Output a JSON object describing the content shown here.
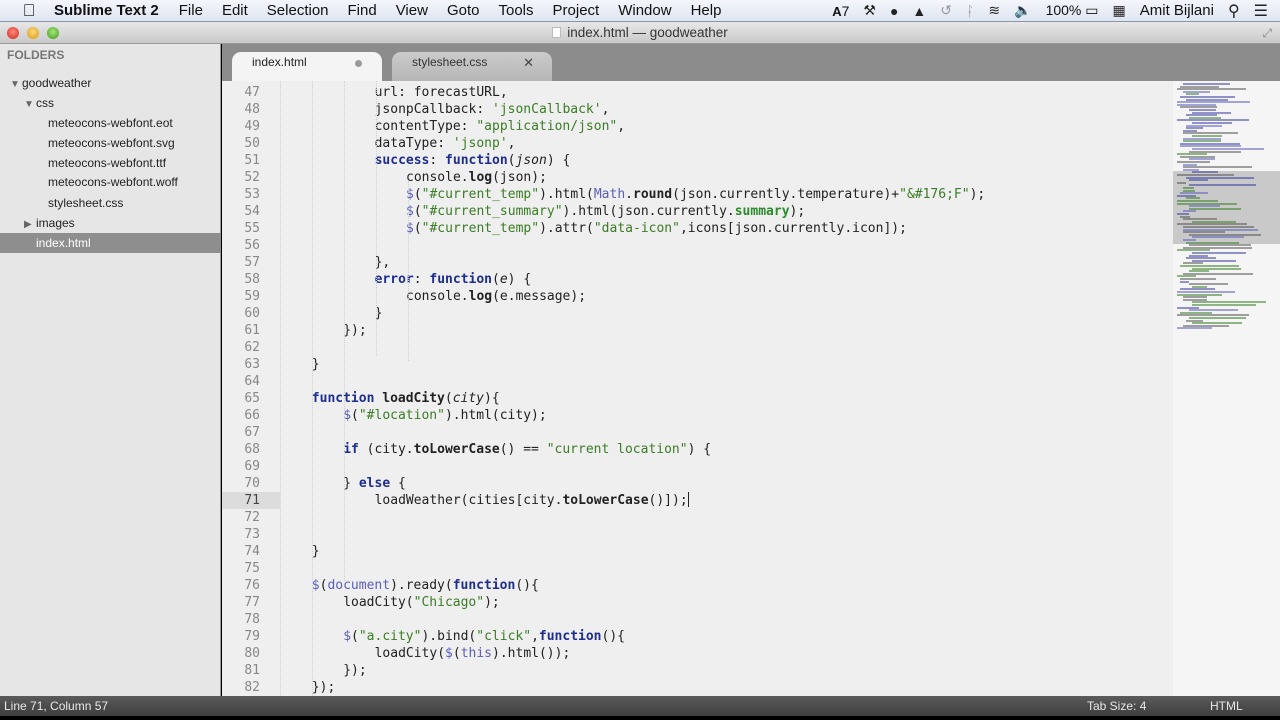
{
  "menubar": {
    "app_name": "Sublime Text 2",
    "items": [
      "File",
      "Edit",
      "Selection",
      "Find",
      "View",
      "Goto",
      "Tools",
      "Project",
      "Window",
      "Help"
    ],
    "status_icons": [
      "adobe-icon",
      "anvil-icon",
      "growl-icon",
      "airplay-icon",
      "time-machine-icon",
      "bluetooth-icon",
      "wifi-icon",
      "volume-icon"
    ],
    "adobe_badge": "7",
    "battery": "100%",
    "user": "Amit Bijlani"
  },
  "window": {
    "title": "index.html — goodweather"
  },
  "sidebar": {
    "header": "FOLDERS",
    "tree": [
      {
        "label": "goodweather",
        "type": "folder",
        "expanded": true,
        "depth": 0
      },
      {
        "label": "css",
        "type": "folder",
        "expanded": true,
        "depth": 1
      },
      {
        "label": "meteocons-webfont.eot",
        "type": "file",
        "depth": 2
      },
      {
        "label": "meteocons-webfont.svg",
        "type": "file",
        "depth": 2
      },
      {
        "label": "meteocons-webfont.ttf",
        "type": "file",
        "depth": 2
      },
      {
        "label": "meteocons-webfont.woff",
        "type": "file",
        "depth": 2
      },
      {
        "label": "stylesheet.css",
        "type": "file",
        "depth": 2
      },
      {
        "label": "images",
        "type": "folder",
        "expanded": false,
        "depth": 1
      },
      {
        "label": "index.html",
        "type": "file",
        "depth": 1,
        "selected": true
      }
    ]
  },
  "tabs": [
    {
      "label": "index.html",
      "active": true,
      "dirty": true
    },
    {
      "label": "stylesheet.css",
      "active": false,
      "dirty": false
    }
  ],
  "editor": {
    "current_line": 71,
    "lines": [
      {
        "n": 47,
        "indent": 4,
        "html": "url: forecastURL,"
      },
      {
        "n": 48,
        "indent": 4,
        "html": "jsonpCallback: <span class=\"s\">'jsonCallback'</span>,"
      },
      {
        "n": 49,
        "indent": 4,
        "html": "contentType: <span class=\"s\">\"application/json\"</span>,"
      },
      {
        "n": 50,
        "indent": 4,
        "html": "dataType: <span class=\"s\">'jsonp'</span>,"
      },
      {
        "n": 51,
        "indent": 4,
        "html": "<span class=\"k\">success</span>: <span class=\"f\">function</span>(<span class=\"i\">json</span>) {"
      },
      {
        "n": 52,
        "indent": 5,
        "html": "console.<span class=\"m\">log</span>(json);"
      },
      {
        "n": 53,
        "indent": 5,
        "html": "<span class=\"p\">$</span>(<span class=\"s\">\"#current_temp\"</span>).html(<span class=\"p\">Math</span>.<span class=\"m\">round</span>(json.currently.temperature)+<span class=\"s\">\"&amp;#176;F\"</span>);"
      },
      {
        "n": 54,
        "indent": 5,
        "html": "<span class=\"p\">$</span>(<span class=\"s\">\"#current_summary\"</span>).html(json.currently.<span class=\"g\">summary</span>);"
      },
      {
        "n": 55,
        "indent": 5,
        "html": "<span class=\"p\">$</span>(<span class=\"s\">\"#current_temp\"</span>).attr(<span class=\"s\">\"data-icon\"</span>,icons[json.currently.icon]);"
      },
      {
        "n": 56,
        "indent": 0,
        "html": ""
      },
      {
        "n": 57,
        "indent": 4,
        "html": "},"
      },
      {
        "n": 58,
        "indent": 4,
        "html": "<span class=\"k\">error</span>: <span class=\"f\">function</span>(<span class=\"i\">e</span>) {"
      },
      {
        "n": 59,
        "indent": 5,
        "html": "console.<span class=\"m\">log</span>(e.message);"
      },
      {
        "n": 60,
        "indent": 4,
        "html": "}"
      },
      {
        "n": 61,
        "indent": 3,
        "html": "});"
      },
      {
        "n": 62,
        "indent": 0,
        "html": ""
      },
      {
        "n": 63,
        "indent": 2,
        "html": "}"
      },
      {
        "n": 64,
        "indent": 0,
        "html": ""
      },
      {
        "n": 65,
        "indent": 2,
        "html": "<span class=\"f\">function</span> <span class=\"m\">loadCity</span>(<span class=\"i\">city</span>){"
      },
      {
        "n": 66,
        "indent": 3,
        "html": "<span class=\"p\">$</span>(<span class=\"s\">\"#location\"</span>).html(city);"
      },
      {
        "n": 67,
        "indent": 0,
        "html": ""
      },
      {
        "n": 68,
        "indent": 3,
        "html": "<span class=\"k\">if</span> (city.<span class=\"m\">toLowerCase</span>() == <span class=\"s\">\"current location\"</span>) {"
      },
      {
        "n": 69,
        "indent": 0,
        "html": ""
      },
      {
        "n": 70,
        "indent": 3,
        "html": "} <span class=\"k\">else</span> {"
      },
      {
        "n": 71,
        "indent": 4,
        "html": "loadWeather(cities[city.<span class=\"m\">toLowerCase</span>()]);<span class=\"cursor\"></span>"
      },
      {
        "n": 72,
        "indent": 0,
        "html": ""
      },
      {
        "n": 73,
        "indent": 0,
        "html": ""
      },
      {
        "n": 74,
        "indent": 2,
        "html": "}"
      },
      {
        "n": 75,
        "indent": 0,
        "html": ""
      },
      {
        "n": 76,
        "indent": 2,
        "html": "<span class=\"p\">$</span>(<span class=\"p\">document</span>).ready(<span class=\"f\">function</span>(){"
      },
      {
        "n": 77,
        "indent": 3,
        "html": "loadCity(<span class=\"s\">\"Chicago\"</span>);"
      },
      {
        "n": 78,
        "indent": 0,
        "html": ""
      },
      {
        "n": 79,
        "indent": 3,
        "html": "<span class=\"p\">$</span>(<span class=\"s\">\"a.city\"</span>).bind(<span class=\"s\">\"click\"</span>,<span class=\"f\">function</span>(){"
      },
      {
        "n": 80,
        "indent": 4,
        "html": "loadCity(<span class=\"p\">$</span>(<span class=\"p\">this</span>).html());"
      },
      {
        "n": 81,
        "indent": 3,
        "html": "});"
      },
      {
        "n": 82,
        "indent": 2,
        "html": "});"
      }
    ]
  },
  "statusbar": {
    "position": "Line 71, Column 57",
    "tab_size": "Tab Size: 4",
    "syntax": "HTML"
  }
}
